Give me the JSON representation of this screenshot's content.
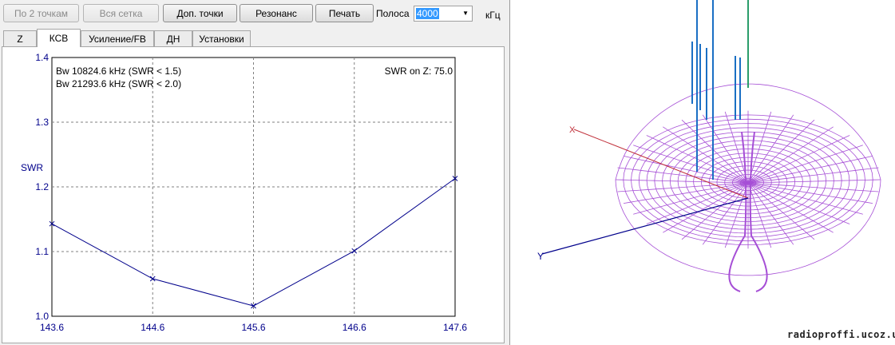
{
  "toolbar": {
    "btn_two_points": "По 2 точкам",
    "btn_full_grid": "Вся сетка",
    "btn_extra_points": "Доп. точки",
    "btn_resonance": "Резонанс",
    "btn_print": "Печать",
    "band_label": "Полоса",
    "band_value": "4000",
    "band_unit": "кГц"
  },
  "tabs": [
    {
      "label": "Z"
    },
    {
      "label": "КСВ",
      "active": true
    },
    {
      "label": "Усиление/FB"
    },
    {
      "label": "ДН"
    },
    {
      "label": "Установки"
    }
  ],
  "chart_data": {
    "type": "line",
    "ylabel": "SWR",
    "annotations": [
      "Bw 10824.6 kHz (SWR < 1.5)",
      "Bw 21293.6 kHz (SWR < 2.0)"
    ],
    "swr_note": "SWR on Z: 75.0",
    "x": [
      143.6,
      144.6,
      145.6,
      146.6,
      147.6
    ],
    "y": [
      1.143,
      1.058,
      1.016,
      1.101,
      1.213
    ],
    "xlim": [
      143.6,
      147.6
    ],
    "ylim": [
      1.0,
      1.4
    ],
    "xticks": [
      "143.6",
      "144.6",
      "145.6",
      "146.6",
      "147.6"
    ],
    "yticks": [
      "1.0",
      "1.1",
      "1.2",
      "1.3",
      "1.4"
    ],
    "grid": true,
    "line_color": "#00008b"
  },
  "pattern_view": {
    "pattern_color": "#a64fd6",
    "axis_labels": [
      "X",
      "Y"
    ],
    "watermark": "radioproffi.ucoz.ua"
  }
}
